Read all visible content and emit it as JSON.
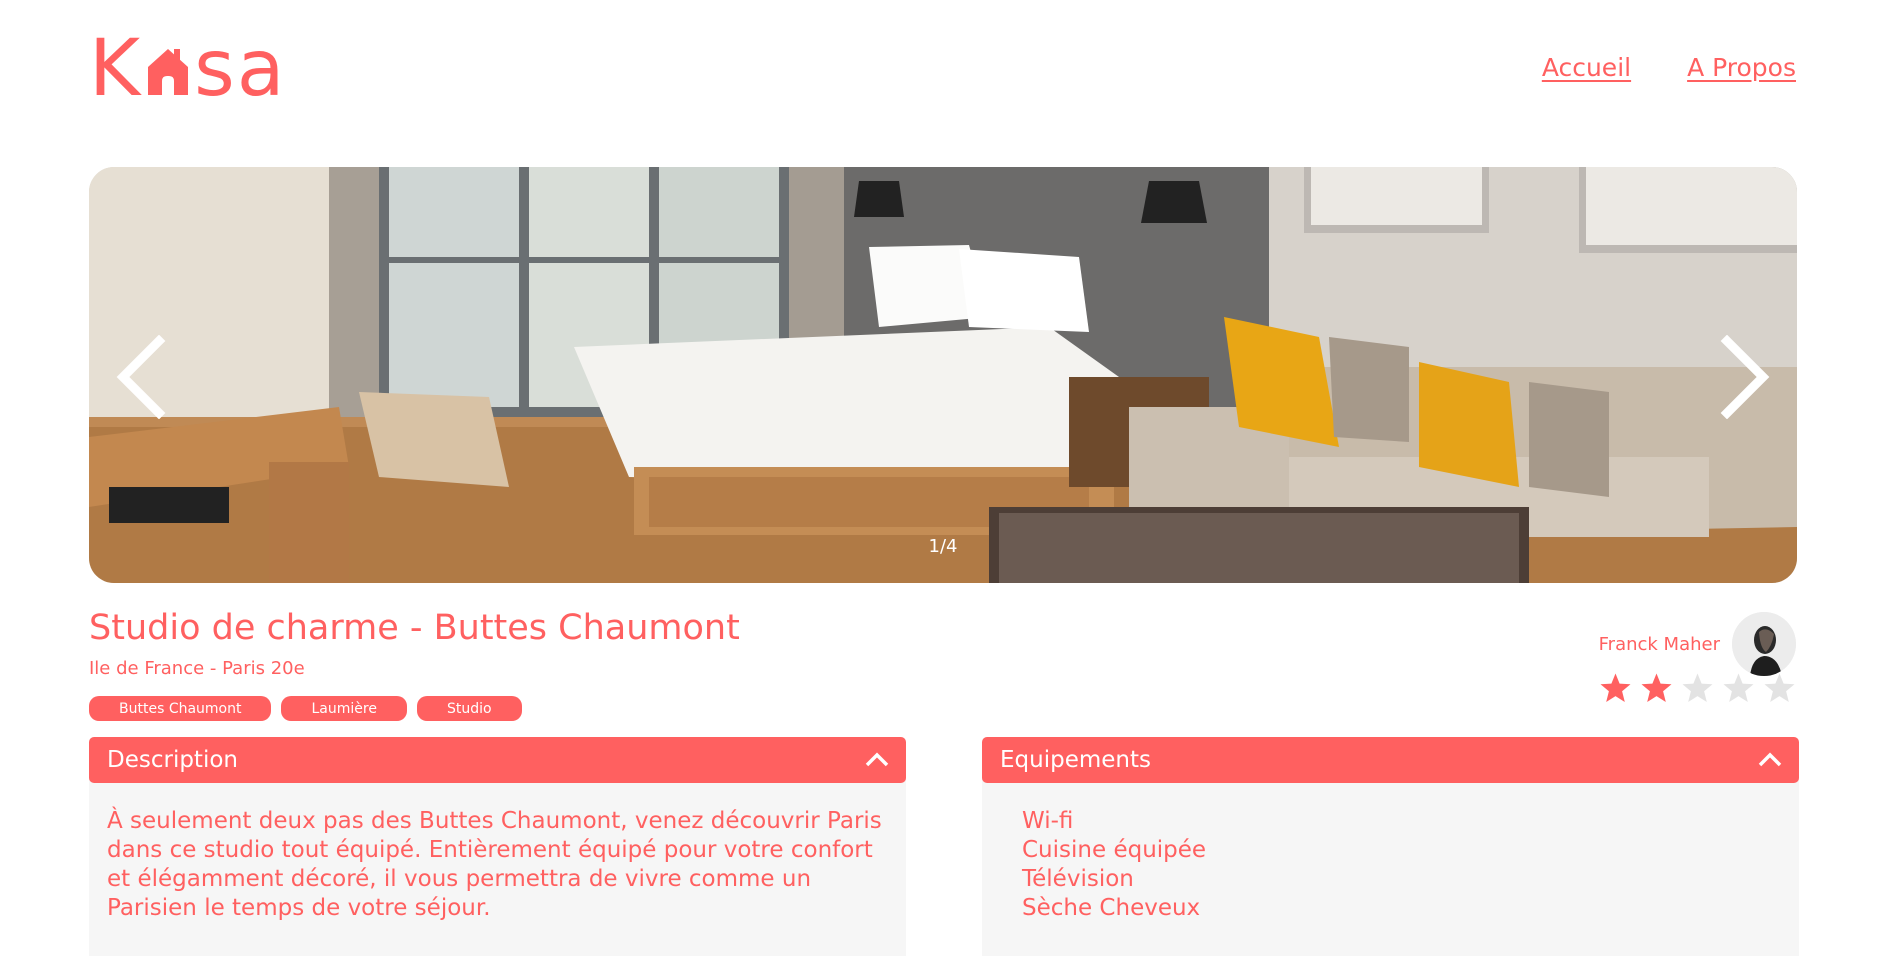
{
  "header": {
    "logo": {
      "letters_before": "K",
      "letters_after": "sa",
      "icon": "house-icon"
    },
    "nav": [
      {
        "label": "Accueil"
      },
      {
        "label": "A Propos"
      }
    ]
  },
  "carousel": {
    "counter": "1/4",
    "prev_icon": "chevron-left-icon",
    "next_icon": "chevron-right-icon"
  },
  "listing": {
    "title": "Studio de charme - Buttes Chaumont",
    "location": "Ile de France - Paris 20e",
    "tags": [
      "Buttes Chaumont",
      "Laumière",
      "Studio"
    ],
    "host_name": "Franck Maher",
    "rating": 2,
    "rating_max": 5
  },
  "description": {
    "title": "Description",
    "text": "À seulement deux pas des Buttes Chaumont, venez découvrir Paris dans ce studio tout équipé. Entièrement équipé pour votre confort et élégamment décoré, il vous permettra de vivre comme un Parisien le temps de votre séjour."
  },
  "equipments": {
    "title": "Equipements",
    "items": [
      "Wi-fi",
      "Cuisine équipée",
      "Télévision",
      "Sèche Cheveux"
    ]
  },
  "colors": {
    "primary": "#FF6060",
    "panel": "#F6F6F6",
    "star_off": "#E3E3E3"
  }
}
